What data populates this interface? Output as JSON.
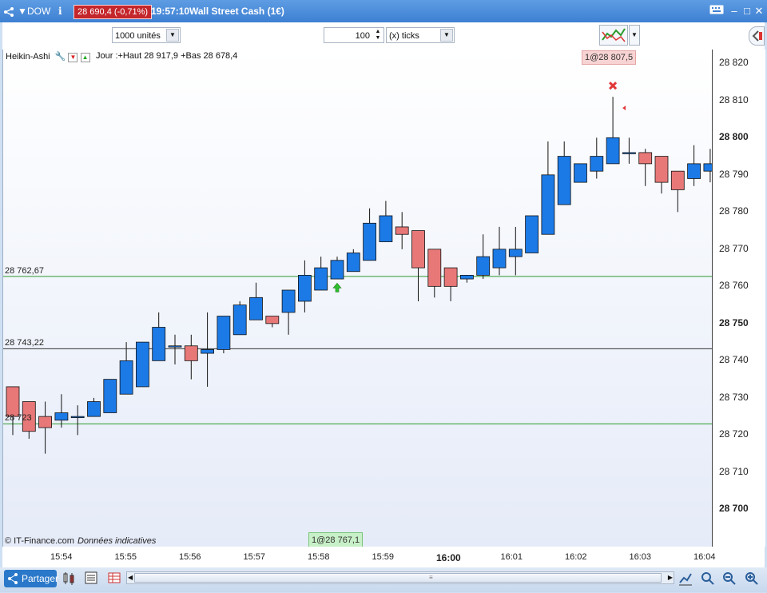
{
  "titlebar": {
    "symbol": "DOW",
    "info_icon": "info-icon",
    "price_badge": "28 690,4 (-0,71%)",
    "time": "19:57:10",
    "instrument": "Wall Street Cash (1€)",
    "colors": {
      "background": "#3d7fd2",
      "badge": "#c4262b"
    }
  },
  "toolbar": {
    "quantity": "1000 unités",
    "ticks_value": "100",
    "ticks_unit": "(x) ticks"
  },
  "chart": {
    "indicator_label": "Heikin-Ashi",
    "day_info": "Jour :+Haut 28 917,9 +Bas 28 678,4",
    "order_top": "1@28 807,5",
    "order_bottom": "1@28 767,1",
    "copyright": "© IT-Finance.com",
    "disclaimer": "Données indicatives",
    "hlines": [
      {
        "label": "28 762,67",
        "value": 28762.67,
        "color": "#2e9a2e"
      },
      {
        "label": "28 743,22",
        "value": 28743.22,
        "color": "#333333"
      },
      {
        "label": "28 723",
        "value": 28723,
        "color": "#2e9a2e"
      }
    ],
    "colors": {
      "up": "#1c7ae6",
      "down": "#e87878"
    }
  },
  "yaxis": {
    "ticks": [
      {
        "label": "28 820",
        "value": 28820,
        "bold": false
      },
      {
        "label": "28 810",
        "value": 28810,
        "bold": false
      },
      {
        "label": "28 800",
        "value": 28800,
        "bold": true
      },
      {
        "label": "28 790",
        "value": 28790,
        "bold": false
      },
      {
        "label": "28 780",
        "value": 28780,
        "bold": false
      },
      {
        "label": "28 770",
        "value": 28770,
        "bold": false
      },
      {
        "label": "28 760",
        "value": 28760,
        "bold": false
      },
      {
        "label": "28 750",
        "value": 28750,
        "bold": true
      },
      {
        "label": "28 740",
        "value": 28740,
        "bold": false
      },
      {
        "label": "28 730",
        "value": 28730,
        "bold": false
      },
      {
        "label": "28 720",
        "value": 28720,
        "bold": false
      },
      {
        "label": "28 710",
        "value": 28710,
        "bold": false
      },
      {
        "label": "28 700",
        "value": 28700,
        "bold": true
      }
    ]
  },
  "xaxis": {
    "ticks": [
      {
        "label": "15:54",
        "bold": false
      },
      {
        "label": "15:55",
        "bold": false
      },
      {
        "label": "15:56",
        "bold": false
      },
      {
        "label": "15:57",
        "bold": false
      },
      {
        "label": "15:58",
        "bold": false
      },
      {
        "label": "15:59",
        "bold": false
      },
      {
        "label": "16:00",
        "bold": true
      },
      {
        "label": "16:01",
        "bold": false
      },
      {
        "label": "16:02",
        "bold": false
      },
      {
        "label": "16:03",
        "bold": false
      },
      {
        "label": "16:04",
        "bold": false
      }
    ]
  },
  "bottombar": {
    "share_label": "Partager"
  },
  "chart_data": {
    "type": "candlestick",
    "ylim": [
      28696,
      28822
    ],
    "candles": [
      {
        "o": 28733,
        "c": 28725,
        "h": 28733,
        "l": 28720
      },
      {
        "o": 28729,
        "c": 28721,
        "h": 28729,
        "l": 28719
      },
      {
        "o": 28725,
        "c": 28722,
        "h": 28729,
        "l": 28715
      },
      {
        "o": 28724,
        "c": 28726,
        "h": 28731,
        "l": 28722
      },
      {
        "o": 28725,
        "c": 28725,
        "h": 28728,
        "l": 28720
      },
      {
        "o": 28725,
        "c": 28729,
        "h": 28730,
        "l": 28725
      },
      {
        "o": 28726,
        "c": 28735,
        "h": 28735,
        "l": 28726
      },
      {
        "o": 28731,
        "c": 28740,
        "h": 28745,
        "l": 28731
      },
      {
        "o": 28733,
        "c": 28745,
        "h": 28745,
        "l": 28733
      },
      {
        "o": 28740,
        "c": 28749,
        "h": 28753,
        "l": 28740
      },
      {
        "o": 28744,
        "c": 28744,
        "h": 28747,
        "l": 28739
      },
      {
        "o": 28744,
        "c": 28740,
        "h": 28747,
        "l": 28735
      },
      {
        "o": 28742,
        "c": 28743,
        "h": 28753,
        "l": 28733
      },
      {
        "o": 28743,
        "c": 28752,
        "h": 28752,
        "l": 28742
      },
      {
        "o": 28747,
        "c": 28755,
        "h": 28756,
        "l": 28747
      },
      {
        "o": 28751,
        "c": 28757,
        "h": 28761,
        "l": 28751
      },
      {
        "o": 28752,
        "c": 28750,
        "h": 28752,
        "l": 28749
      },
      {
        "o": 28753,
        "c": 28759,
        "h": 28759,
        "l": 28747
      },
      {
        "o": 28756,
        "c": 28763,
        "h": 28767,
        "l": 28753
      },
      {
        "o": 28759,
        "c": 28765,
        "h": 28768,
        "l": 28759
      },
      {
        "o": 28762,
        "c": 28767,
        "h": 28768,
        "l": 28762
      },
      {
        "o": 28764,
        "c": 28769,
        "h": 28770,
        "l": 28764
      },
      {
        "o": 28767,
        "c": 28777,
        "h": 28781,
        "l": 28767
      },
      {
        "o": 28772,
        "c": 28779,
        "h": 28783,
        "l": 28772
      },
      {
        "o": 28776,
        "c": 28774,
        "h": 28780,
        "l": 28770
      },
      {
        "o": 28775,
        "c": 28765,
        "h": 28775,
        "l": 28756
      },
      {
        "o": 28770,
        "c": 28760,
        "h": 28770,
        "l": 28757
      },
      {
        "o": 28765,
        "c": 28760,
        "h": 28765,
        "l": 28756
      },
      {
        "o": 28762,
        "c": 28763,
        "h": 28763,
        "l": 28761
      },
      {
        "o": 28763,
        "c": 28768,
        "h": 28774,
        "l": 28762
      },
      {
        "o": 28765,
        "c": 28770,
        "h": 28776,
        "l": 28763
      },
      {
        "o": 28768,
        "c": 28770,
        "h": 28776,
        "l": 28763
      },
      {
        "o": 28769,
        "c": 28779,
        "h": 28779,
        "l": 28769
      },
      {
        "o": 28774,
        "c": 28790,
        "h": 28799,
        "l": 28774
      },
      {
        "o": 28782,
        "c": 28795,
        "h": 28799,
        "l": 28782
      },
      {
        "o": 28788,
        "c": 28793,
        "h": 28793,
        "l": 28788
      },
      {
        "o": 28791,
        "c": 28795,
        "h": 28800,
        "l": 28789
      },
      {
        "o": 28793,
        "c": 28800,
        "h": 28811,
        "l": 28793
      },
      {
        "o": 28796,
        "c": 28796,
        "h": 28800,
        "l": 28793
      },
      {
        "o": 28796,
        "c": 28793,
        "h": 28797,
        "l": 28787
      },
      {
        "o": 28795,
        "c": 28788,
        "h": 28795,
        "l": 28785
      },
      {
        "o": 28791,
        "c": 28786,
        "h": 28791,
        "l": 28780
      },
      {
        "o": 28789,
        "c": 28793,
        "h": 28798,
        "l": 28787
      },
      {
        "o": 28791,
        "c": 28793,
        "h": 28797,
        "l": 28788
      }
    ]
  }
}
